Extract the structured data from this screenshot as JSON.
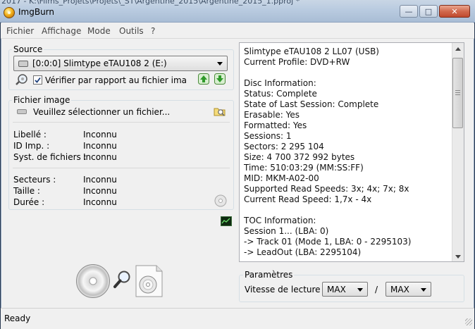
{
  "window": {
    "behind_title": "2017 - K:\\Films_Projets\\Projets\\_ST\\Argentine_2015\\Argentine_2015_1.pproj *",
    "title": "ImgBurn"
  },
  "menu": [
    "Fichier",
    "Affichage",
    "Mode",
    "Outils",
    "?"
  ],
  "source": {
    "label": "Source",
    "drive": "[0:0:0] Slimtype eTAU108   2 (E:)",
    "verify_label": "Vérifier par rapport au fichier ima",
    "verify_checked": true
  },
  "image_file": {
    "label": "Fichier image",
    "placeholder": "Veuillez sélectionner un fichier..."
  },
  "properties": [
    {
      "label": "Libellé :",
      "value": "Inconnu"
    },
    {
      "label": "ID Imp. :",
      "value": "Inconnu"
    },
    {
      "label": "Syst. de fichiers :",
      "value": "Inconnu"
    }
  ],
  "stats": [
    {
      "label": "Secteurs :",
      "value": "Inconnu"
    },
    {
      "label": "Taille :",
      "value": "Inconnu"
    },
    {
      "label": "Durée :",
      "value": "Inconnu"
    }
  ],
  "info_lines": [
    "Slimtype eTAU108   2 LL07 (USB)",
    "Current Profile: DVD+RW",
    "",
    "Disc Information:",
    "Status: Complete",
    "State of Last Session: Complete",
    "Erasable: Yes",
    "Formatted: Yes",
    "Sessions: 1",
    "Sectors: 2 295 104",
    "Size: 4 700 372 992 bytes",
    "Time: 510:03:29 (MM:SS:FF)",
    "MID: MKM-A02-00",
    "Supported Read Speeds: 3x; 4x; 7x; 8x",
    "Current Read Speed: 1,7x - 4x",
    "",
    "TOC Information:",
    "Session 1... (LBA: 0)",
    "-> Track 01  (Mode 1, LBA: 0 - 2295103)",
    "-> LeadOut  (LBA: 2295104)"
  ],
  "params": {
    "label": "Paramètres",
    "read_speed_label": "Vitesse de lecture :",
    "speed_min": "MAX",
    "separator": "/",
    "speed_max": "MAX"
  },
  "status": "Ready",
  "icons": {
    "app": "imgburn-flame-icon",
    "drive_refresh": "magnifier-disc-icon",
    "arrow_up": "green-up-arrow-icon",
    "arrow_down": "green-down-arrow-icon",
    "browse": "browse-folder-icon",
    "log": "log-window-icon",
    "action_read": "disc-to-file-icon"
  }
}
